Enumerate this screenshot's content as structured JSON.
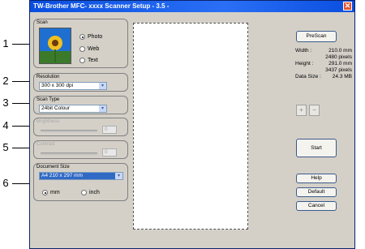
{
  "window": {
    "title": "TW-Brother MFC- xxxx    Scanner Setup - 3.5 -",
    "close_symbol": "✕"
  },
  "callouts": [
    "1",
    "2",
    "3",
    "4",
    "5",
    "6"
  ],
  "scan": {
    "label": "Scan",
    "options": [
      "Photo",
      "Web",
      "Text"
    ],
    "selected": "Photo"
  },
  "resolution": {
    "label": "Resolution",
    "value": "300 x 300 dpi"
  },
  "scan_type": {
    "label": "Scan Type",
    "value": "24bit Colour"
  },
  "brightness": {
    "label": "Brightness",
    "value": "0"
  },
  "contrast": {
    "label": "Contrast",
    "value": "0"
  },
  "document_size": {
    "label": "Document Size",
    "value": "A4 210 x 297 mm",
    "units": [
      "mm",
      "inch"
    ],
    "selected_unit": "mm"
  },
  "buttons": {
    "prescan": "PreScan",
    "start": "Start",
    "help": "Help",
    "default": "Default",
    "cancel": "Cancel"
  },
  "info": {
    "width_label": "Width :",
    "width_mm": "210.0 mm",
    "width_px": "2480 pixels",
    "height_label": "Height :",
    "height_mm": "291.0 mm",
    "height_px": "3437 pixels",
    "size_label": "Data Size :",
    "size_value": "24.3 MB"
  },
  "arrow_glyph": "▾",
  "zoom_in_glyph": "+",
  "zoom_out_glyph": "−"
}
